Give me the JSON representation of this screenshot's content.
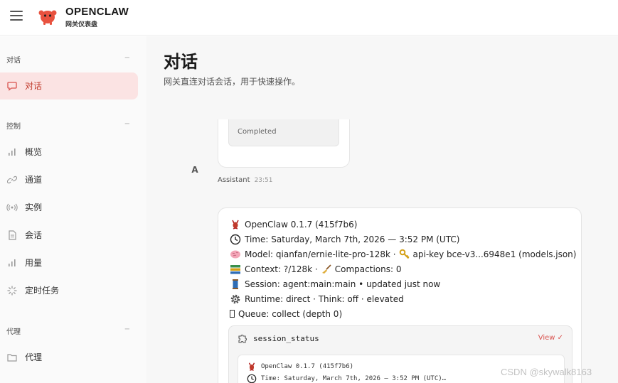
{
  "app": {
    "brand_title": "OPENCLAW",
    "brand_subtitle": "网关仪表盘",
    "accent_color": "#d9534f"
  },
  "sidebar": {
    "sections": [
      {
        "label": "对话",
        "collapse": "−"
      },
      {
        "label": "控制",
        "collapse": "−"
      },
      {
        "label": "代理",
        "collapse": "−"
      }
    ],
    "items": [
      {
        "label": "对话",
        "icon": "chat-bubble-icon",
        "active": true
      },
      {
        "label": "概览",
        "icon": "bar-chart-icon"
      },
      {
        "label": "通道",
        "icon": "link-icon"
      },
      {
        "label": "实例",
        "icon": "broadcast-icon"
      },
      {
        "label": "会话",
        "icon": "document-icon"
      },
      {
        "label": "用量",
        "icon": "bar-chart-icon"
      },
      {
        "label": "定时任务",
        "icon": "loader-icon"
      },
      {
        "label": "代理",
        "icon": "folder-icon"
      }
    ]
  },
  "main": {
    "title": "对话",
    "subtitle": "网关直连对话会话，用于快速操作。",
    "prev_message": {
      "status": "Completed"
    },
    "assistant": {
      "avatar": "A",
      "name": "Assistant",
      "time": "23:51"
    },
    "status_lines": [
      {
        "icon": "lobster-icon",
        "text": "OpenClaw 0.1.7 (415f7b6)"
      },
      {
        "icon": "clock-icon",
        "text": "Time: Saturday, March 7th, 2026 — 3:52 PM (UTC)"
      },
      {
        "icon": "brain-icon",
        "text": "Model: qianfan/ernie-lite-pro-128k ·",
        "icon2": "key-icon",
        "text2": "api-key bce-v3...6948e1 (models.json)"
      },
      {
        "icon": "books-icon",
        "text": "Context: ?/128k ·",
        "icon2": "broom-icon",
        "text2": "Compactions: 0"
      },
      {
        "icon": "thread-icon",
        "text": "Session: agent:main:main • updated just now"
      },
      {
        "icon": "gear-icon",
        "text": "Runtime: direct · Think: off · elevated"
      },
      {
        "icon": "queue-icon",
        "text": "Queue: collect (depth 0)"
      }
    ],
    "tool": {
      "name": "session_status",
      "view_label": "View ✓",
      "output_lines": [
        {
          "icon": "lobster-icon",
          "text": "OpenClaw 0.1.7 (415f7b6)"
        },
        {
          "icon": "clock-icon",
          "text": "Time: Saturday, March 7th, 2026 — 3:52 PM (UTC)…"
        }
      ]
    }
  },
  "watermark": "CSDN @skywalk8163"
}
